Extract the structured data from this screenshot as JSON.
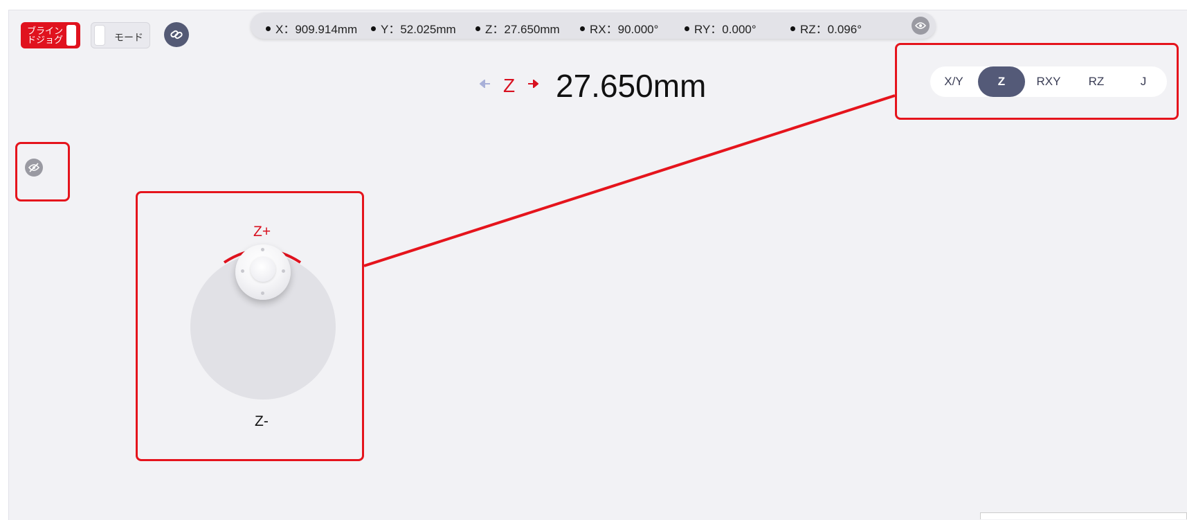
{
  "header": {
    "blind_jog_label": "ブラインドジョグ",
    "mode_label": "モード",
    "link_icon": "link-icon"
  },
  "coords": [
    {
      "label": "X：909.914mm"
    },
    {
      "label": "Y：52.025mm"
    },
    {
      "label": "Z：27.650mm"
    },
    {
      "label": "RX：90.000°"
    },
    {
      "label": "RY：0.000°"
    },
    {
      "label": "RZ：0.096°"
    }
  ],
  "current_axis": {
    "name": "Z",
    "value": "27.650mm"
  },
  "axis_tabs": [
    {
      "label": "X/Y",
      "active": false
    },
    {
      "label": "Z",
      "active": true
    },
    {
      "label": "RXY",
      "active": false
    },
    {
      "label": "RZ",
      "active": false
    },
    {
      "label": "J",
      "active": false
    }
  ],
  "joystick": {
    "plus_label": "Z+",
    "minus_label": "Z-"
  },
  "colors": {
    "accent_red": "#e0121e",
    "tab_active": "#545a78",
    "background": "#f2f2f5"
  },
  "icons": [
    "link-icon",
    "eye-icon",
    "eye-off-icon",
    "arrow-left-icon",
    "arrow-right-icon"
  ]
}
